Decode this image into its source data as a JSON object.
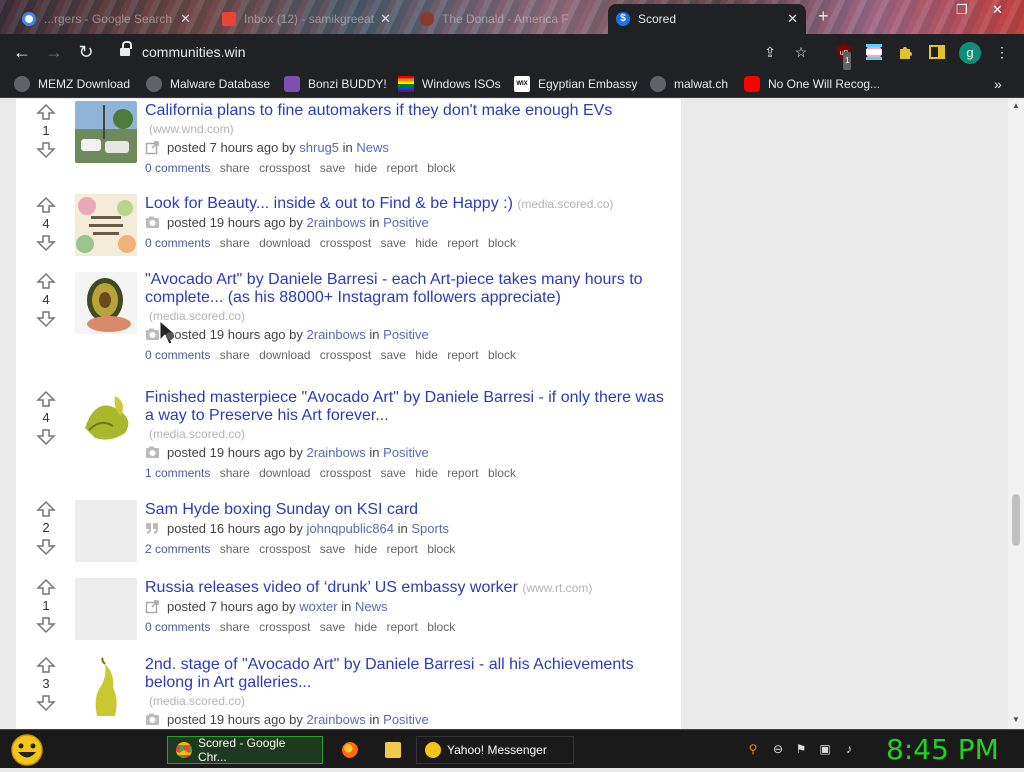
{
  "browser": {
    "tabs": [
      {
        "title": "...rgers - Google Search",
        "icon": "google-icon"
      },
      {
        "title": "Inbox (12) - samikgreeat",
        "icon": "gmail-icon"
      },
      {
        "title": "The Donald - America F",
        "icon": "site-icon"
      },
      {
        "title": "Scored",
        "icon": "scored-icon",
        "active": true
      }
    ],
    "close_glyph": "✕",
    "new_tab_glyph": "+",
    "address": "communities.win",
    "profile_initial": "g",
    "ublock_badge": "1"
  },
  "bookmarks": [
    {
      "label": "MEMZ Download",
      "icon": "globe-icon"
    },
    {
      "label": "Malware Database",
      "icon": "globe-icon"
    },
    {
      "label": "Bonzi BUDDY!",
      "icon": "bonzi-icon"
    },
    {
      "label": "Windows ISOs",
      "icon": "windows-icon"
    },
    {
      "label": "Egyptian Embassy",
      "icon": "wix-icon"
    },
    {
      "label": "malwat.ch",
      "icon": "globe-icon"
    },
    {
      "label": "No One Will Recog...",
      "icon": "youtube-icon"
    }
  ],
  "bookmarks_more": "»",
  "posts": [
    {
      "votes": "1",
      "title": "California plans to fine automakers if they don't make enough EVs",
      "domain": "(www.wnd.com)",
      "meta_type": "link",
      "posted": "posted 7 hours ago by",
      "author": "shrug5",
      "in": "in",
      "community": "News",
      "comments": "0 comments",
      "actions": [
        "share",
        "crosspost",
        "save",
        "hide",
        "report",
        "block"
      ]
    },
    {
      "votes": "4",
      "title": "Look for Beauty... inside & out to Find & be Happy :)",
      "domain": "(media.scored.co)",
      "meta_type": "image",
      "posted": "posted 19 hours ago by",
      "author": "2rainbows",
      "in": "in",
      "community": "Positive",
      "comments": "0 comments",
      "actions": [
        "share",
        "download",
        "crosspost",
        "save",
        "hide",
        "report",
        "block"
      ]
    },
    {
      "votes": "4",
      "title": "\"Avocado Art\" by Daniele Barresi - each Art-piece takes many hours to complete... (as his 88000+ Instagram followers appreciate)",
      "domain": "(media.scored.co)",
      "meta_type": "image",
      "posted": "posted 19 hours ago by",
      "author": "2rainbows",
      "in": "in",
      "community": "Positive",
      "comments": "0 comments",
      "actions": [
        "share",
        "download",
        "crosspost",
        "save",
        "hide",
        "report",
        "block"
      ]
    },
    {
      "votes": "4",
      "title": "Finished masterpiece \"Avocado Art\" by Daniele Barresi - if only there was a way to Preserve his Art forever...",
      "domain": "(media.scored.co)",
      "meta_type": "image",
      "posted": "posted 19 hours ago by",
      "author": "2rainbows",
      "in": "in",
      "community": "Positive",
      "comments": "1 comments",
      "actions": [
        "share",
        "download",
        "crosspost",
        "save",
        "hide",
        "report",
        "block"
      ]
    },
    {
      "votes": "2",
      "title": "Sam Hyde boxing Sunday on KSI card",
      "domain": "",
      "meta_type": "text",
      "posted": "posted 16 hours ago by",
      "author": "johnqpublic864",
      "in": "in",
      "community": "Sports",
      "comments": "2 comments",
      "actions": [
        "share",
        "crosspost",
        "save",
        "hide",
        "report",
        "block"
      ]
    },
    {
      "votes": "1",
      "title": "Russia releases video of ‘drunk’ US embassy worker",
      "domain": "(www.rt.com)",
      "meta_type": "link",
      "posted": "posted 7 hours ago by",
      "author": "woxter",
      "in": "in",
      "community": "News",
      "comments": "0 comments",
      "actions": [
        "share",
        "crosspost",
        "save",
        "hide",
        "report",
        "block"
      ]
    },
    {
      "votes": "3",
      "title": "2nd. stage of \"Avocado Art\" by Daniele Barresi - all his Achievements belong in Art galleries...",
      "domain": "(media.scored.co)",
      "meta_type": "image",
      "posted": "posted 19 hours ago by",
      "author": "2rainbows",
      "in": "in",
      "community": "Positive",
      "comments": "",
      "actions": []
    }
  ],
  "taskbar": {
    "tasks": [
      {
        "label": "Scored - Google Chr...",
        "icon": "chrome-icon",
        "active": true
      },
      {
        "label": "",
        "icon": "firefox-icon"
      },
      {
        "label": "",
        "icon": "folder-icon"
      },
      {
        "label": "Yahoo! Messenger",
        "icon": "yahoo-messenger-icon"
      }
    ],
    "clock": "8:45 PM"
  },
  "colors": {
    "title_link": "#2d3bb8",
    "meta_link": "#5a6bb0",
    "clock": "#22d222"
  }
}
